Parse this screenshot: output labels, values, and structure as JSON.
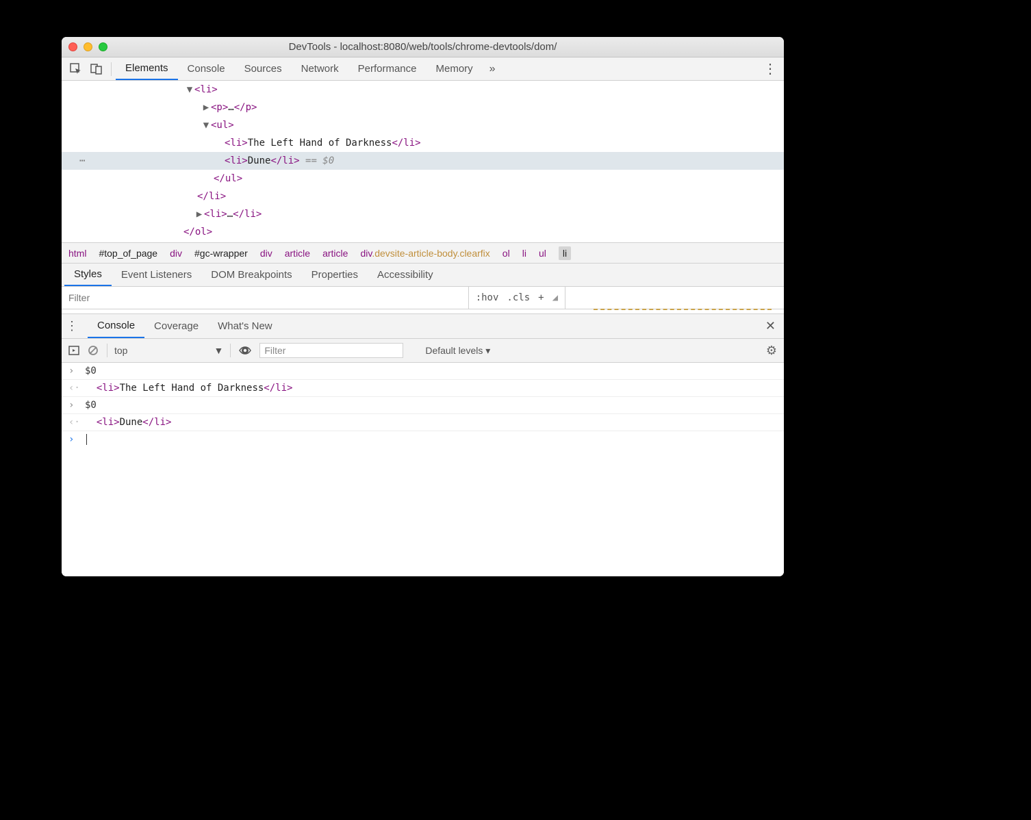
{
  "window": {
    "title": "DevTools - localhost:8080/web/tools/chrome-devtools/dom/"
  },
  "tabs": [
    "Elements",
    "Console",
    "Sources",
    "Network",
    "Performance",
    "Memory"
  ],
  "activeTab": "Elements",
  "elementsTree": {
    "line1_open": "<li>",
    "line2_open": "<p>",
    "line2_ellipsis": "…",
    "line2_close": "</p>",
    "line3_open": "<ul>",
    "line4_open": "<li>",
    "line4_text": "The Left Hand of Darkness",
    "line4_close": "</li>",
    "line5_open": "<li>",
    "line5_text": "Dune",
    "line5_close": "</li>",
    "line5_suffix": " == $0",
    "line6": "</ul>",
    "line7": "</li>",
    "line8_open": "<li>",
    "line8_ellipsis": "…",
    "line8_close": "</li>",
    "line9": "</ol>"
  },
  "breadcrumbs": [
    {
      "label": "html",
      "type": "tag"
    },
    {
      "label": "#top_of_page",
      "type": "idhash"
    },
    {
      "label": "div",
      "type": "tag"
    },
    {
      "label": "#gc-wrapper",
      "type": "idhash"
    },
    {
      "label": "div",
      "type": "tag"
    },
    {
      "label": "article",
      "type": "tag"
    },
    {
      "label": "article",
      "type": "tag"
    },
    {
      "label": "div",
      "classname": ".devsite-article-body.clearfix",
      "type": "cls"
    },
    {
      "label": "ol",
      "type": "tag"
    },
    {
      "label": "li",
      "type": "tag"
    },
    {
      "label": "ul",
      "type": "tag"
    },
    {
      "label": "li",
      "type": "selected"
    }
  ],
  "stylesTabs": [
    "Styles",
    "Event Listeners",
    "DOM Breakpoints",
    "Properties",
    "Accessibility"
  ],
  "activeStylesTab": "Styles",
  "filter": {
    "placeholder": "Filter",
    "hov": ":hov",
    "cls": ".cls",
    "plus": "+"
  },
  "drawerTabs": [
    "Console",
    "Coverage",
    "What's New"
  ],
  "activeDrawerTab": "Console",
  "consoleToolbar": {
    "context": "top",
    "filterPlaceholder": "Filter",
    "levels": "Default levels ▾"
  },
  "consoleLines": [
    {
      "kind": "in",
      "raw": "$0"
    },
    {
      "kind": "out",
      "html": "  <li>The Left Hand of Darkness</li>"
    },
    {
      "kind": "in",
      "raw": "$0"
    },
    {
      "kind": "out",
      "html": "  <li>Dune</li>"
    }
  ]
}
